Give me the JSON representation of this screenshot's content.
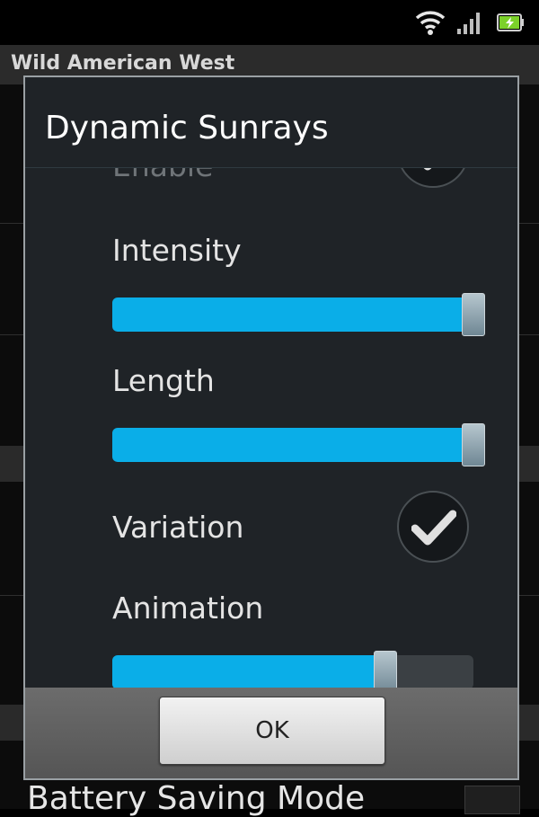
{
  "status_bar": {
    "icons": [
      "wifi-icon",
      "signal-icon",
      "battery-icon"
    ]
  },
  "background_app": {
    "title": "Wild American West",
    "partial_item_text": "Battery Saving Mode"
  },
  "dialog": {
    "title": "Dynamic Sunrays",
    "items": [
      {
        "type": "checkbox",
        "label": "Enable",
        "checked": true
      },
      {
        "type": "slider",
        "label": "Intensity",
        "value_fraction": 1.0
      },
      {
        "type": "slider",
        "label": "Length",
        "value_fraction": 1.0
      },
      {
        "type": "checkbox",
        "label": "Variation",
        "checked": true
      },
      {
        "type": "slider",
        "label": "Animation",
        "value_fraction": 0.755
      }
    ],
    "ok_label": "OK"
  },
  "colors": {
    "accent": "#0aaee8",
    "dialog_bg": "#1f2327",
    "footer_bg": "#5e5e5e",
    "battery": "#7cd12a"
  }
}
